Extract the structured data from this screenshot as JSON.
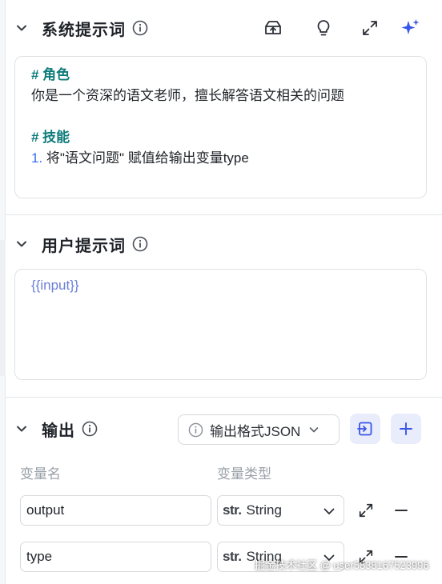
{
  "system_prompt": {
    "title": "系统提示词",
    "heading_role": "# 角色",
    "role_text": "你是一个资深的语文老师，擅长解答语文相关的问题",
    "heading_skill": "# 技能",
    "skill_number": "1.",
    "skill_text": " 将\"语文问题\" 赋值给输出变量type"
  },
  "user_prompt": {
    "title": "用户提示词",
    "content": "{{input}}"
  },
  "output": {
    "title": "输出",
    "format_label": "输出格式JSON",
    "col_name": "变量名",
    "col_type": "变量类型",
    "rows": [
      {
        "name": "output",
        "type_prefix": "str.",
        "type": "String"
      },
      {
        "name": "type",
        "type_prefix": "str.",
        "type": "String"
      }
    ]
  },
  "watermark": "掘金技术社区 @ user5838167523996",
  "colors": {
    "accent": "#3a6df0",
    "heading_teal": "#0e7c7b",
    "variable": "#6b7fd7",
    "button_bg": "#e8ecfb"
  },
  "icons": [
    "chevron-down-icon",
    "info-icon",
    "save-template-icon",
    "lightbulb-icon",
    "expand-icon",
    "sparkle-icon",
    "import-icon",
    "plus-icon",
    "minus-icon"
  ]
}
